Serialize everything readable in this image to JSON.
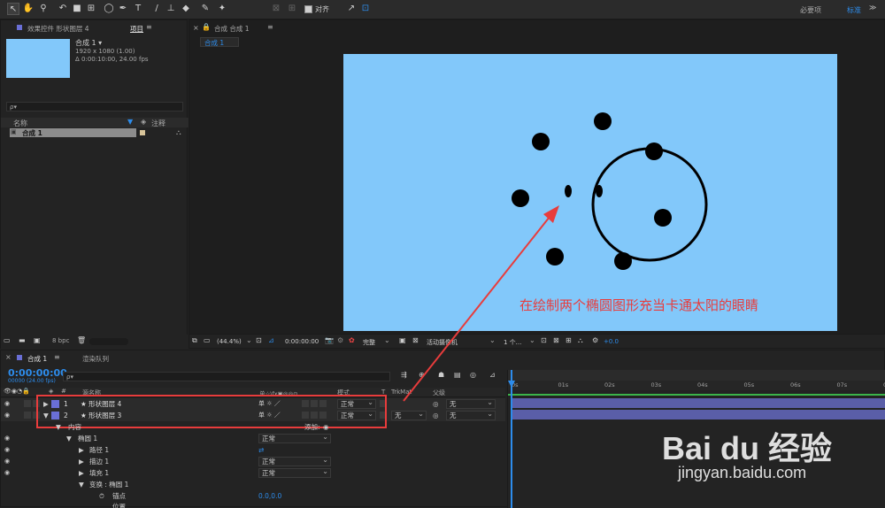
{
  "toolbar": {
    "align_label": "对齐",
    "workspace_label": "必要项",
    "standard_label": "标准"
  },
  "left_panel": {
    "tab_effects": "效果控件 形状图层 4",
    "tab_project": "项目",
    "comp_name": "合成 1 ▾",
    "comp_info_1": "1920 x 1080 (1.00)",
    "comp_info_2": "Δ 0:00:10:00, 24.00 fps",
    "search_placeholder": "ρ▾",
    "col_name": "名称",
    "col_comment": "注释",
    "item_name": "合成 1",
    "bpc_label": "8 bpc"
  },
  "comp_panel": {
    "tab_label": "合成 合成 1",
    "subtab_label": "合成 1",
    "zoom": "(44.4%)",
    "timecode": "0:00:00:00",
    "quality": "完整",
    "camera": "活动摄像机",
    "views": "1 个...",
    "exposure": "+0.0"
  },
  "annotation": "在绘制两个椭圆图形充当卡通太阳的眼睛",
  "timeline": {
    "tab_comp": "合成 1",
    "tab_render": "渲染队列",
    "timecode": "0:00:00:00",
    "frames": "00000 (24.00 fps)",
    "search_placeholder": "ρ▾",
    "col_source": "源名称",
    "col_switches": "单☆\\fx▣◎◎⊙",
    "col_mode": "模式",
    "col_t": "T",
    "col_trkmat": "TrkMat",
    "col_parent": "父级",
    "ticks": [
      "0s",
      "01s",
      "02s",
      "03s",
      "04s",
      "05s",
      "06s",
      "07s",
      "08s"
    ],
    "layers": [
      {
        "num": "1",
        "name": "★ 形状图层 4",
        "mode": "正常",
        "trkmat": "",
        "parent": "无"
      },
      {
        "num": "2",
        "name": "★ 形状图层 3",
        "mode": "正常",
        "trkmat": "无",
        "parent": "无"
      }
    ],
    "props": {
      "contents": "内容",
      "add": "添加:",
      "ellipse": "椭圆 1",
      "ellipse_mode": "正常",
      "path": "路径 1",
      "stroke": "描边 1",
      "stroke_mode": "正常",
      "fill": "填充 1",
      "fill_mode": "正常",
      "transform": "变换 : 椭圆 1",
      "anchor": "锚点",
      "anchor_val": "0.0,0.0",
      "position": "位置"
    }
  },
  "watermark": {
    "brand": "Bai du 经验",
    "url": "jingyan.baidu.com"
  },
  "colors": {
    "canvas": "#82c8fa",
    "accent": "#2d8ceb",
    "annotation": "#e83c3c",
    "layer_color": "#6a6fd6"
  }
}
